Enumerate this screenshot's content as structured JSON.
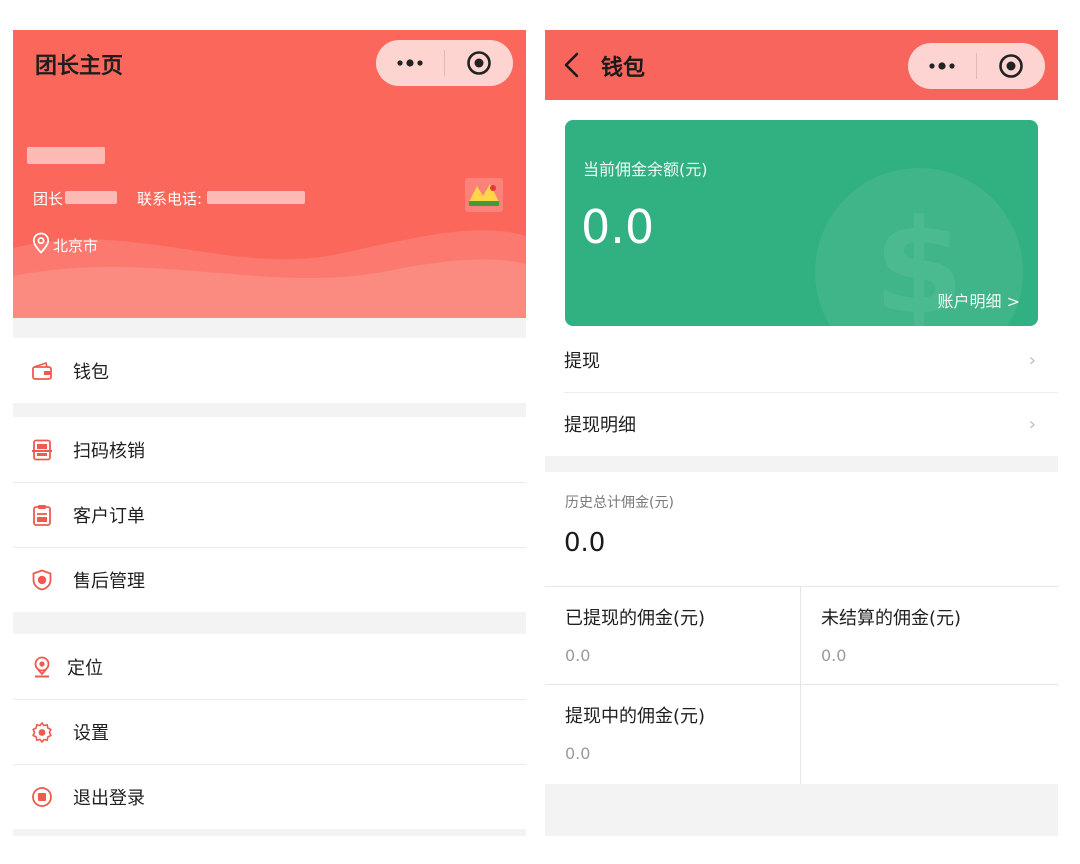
{
  "left": {
    "header": {
      "title": "团长主页",
      "leader_prefix": "团长",
      "phone_prefix": "联系电话:",
      "location": "北京市"
    },
    "menu_groups": [
      [
        {
          "label": "钱包",
          "icon": "wallet-icon"
        }
      ],
      [
        {
          "label": "扫码核销",
          "icon": "scan-icon"
        },
        {
          "label": "客户订单",
          "icon": "order-icon"
        },
        {
          "label": "售后管理",
          "icon": "aftersale-icon"
        }
      ],
      [
        {
          "label": "定位",
          "icon": "location-icon"
        },
        {
          "label": "设置",
          "icon": "gear-icon"
        },
        {
          "label": "退出登录",
          "icon": "logout-icon"
        }
      ]
    ]
  },
  "right": {
    "nav_title": "钱包",
    "card": {
      "label": "当前佣金余额(元)",
      "amount": "0.0",
      "detail_link": "账户明细 >"
    },
    "rows": [
      {
        "label": "提现",
        "arrow": "›"
      },
      {
        "label": "提现明细",
        "arrow": "›"
      }
    ],
    "history": {
      "label": "历史总计佣金(元)",
      "value": "0.0"
    },
    "cells": [
      {
        "title": "已提现的佣金(元)",
        "value": "0.0"
      },
      {
        "title": "未结算的佣金(元)",
        "value": "0.0"
      },
      {
        "title": "提现中的佣金(元)",
        "value": "0.0"
      }
    ]
  },
  "colors": {
    "header_red": "#fb675b",
    "card_green": "#31b081",
    "icon_red": "#f05a4e"
  }
}
